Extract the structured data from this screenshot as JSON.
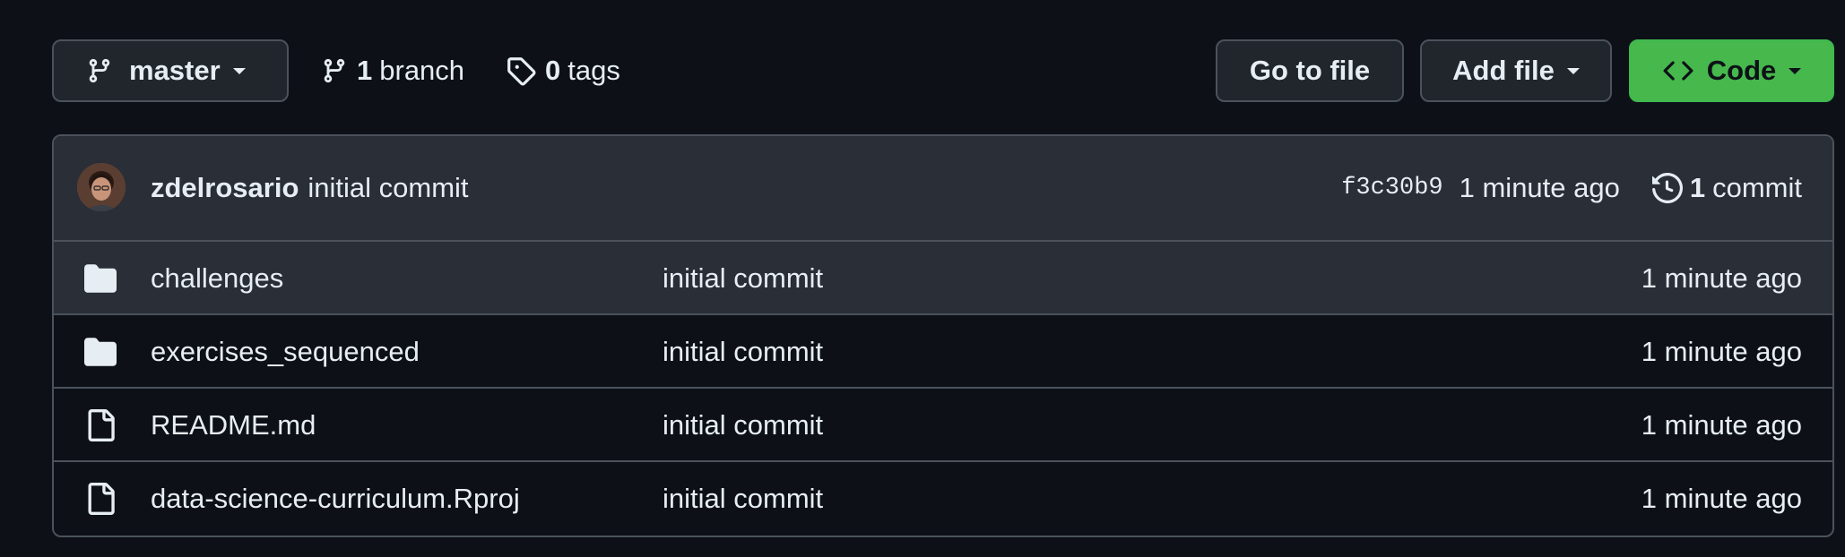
{
  "toolbar": {
    "branch_button": {
      "label": "master",
      "icon": "git-branch-icon"
    },
    "branches": {
      "count": "1",
      "label": "branch"
    },
    "tags": {
      "count": "0",
      "label": "tags"
    },
    "goto_file_label": "Go to file",
    "add_file_label": "Add file",
    "code_label": "Code",
    "colors": {
      "code_button_bg": "#46b84c"
    }
  },
  "latest_commit": {
    "author": "zdelrosario",
    "message": "initial commit",
    "sha": "f3c30b9",
    "time": "1 minute ago",
    "commit_count": "1",
    "commit_count_label": "commit"
  },
  "files": [
    {
      "type": "folder",
      "icon": "folder-icon",
      "name": "challenges",
      "message": "initial commit",
      "age": "1 minute ago"
    },
    {
      "type": "folder",
      "icon": "folder-icon",
      "name": "exercises_sequenced",
      "message": "initial commit",
      "age": "1 minute ago"
    },
    {
      "type": "file",
      "icon": "file-icon",
      "name": "README.md",
      "message": "initial commit",
      "age": "1 minute ago"
    },
    {
      "type": "file",
      "icon": "file-icon",
      "name": "data-science-curriculum.Rproj",
      "message": "initial commit",
      "age": "1 minute ago"
    }
  ]
}
